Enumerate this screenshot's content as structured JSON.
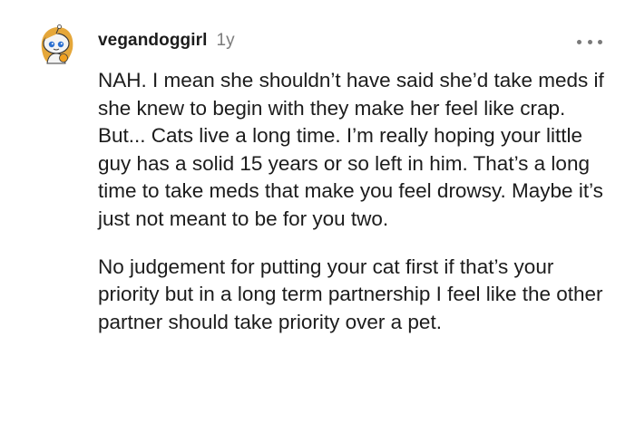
{
  "comment": {
    "username": "vegandoggirl",
    "age": "1y",
    "paragraphs": [
      "NAH. I mean she shouldn’t have said she’d take meds if she knew to begin with they make her feel like crap. But... Cats live a long time. I’m really hoping your little guy has a solid 15 years or so left in him. That’s a long time to take meds that make you feel drowsy. Maybe it’s just not meant to be for you two.",
      "No judgement for putting your cat first if that’s your priority but in a long term partnership I feel like the other partner should take priority over a pet."
    ]
  },
  "icons": {
    "avatar": "snoo-avatar-icon",
    "more": "more-options-icon"
  },
  "colors": {
    "username": "#1c1c1c",
    "age": "#7c7c7c",
    "body_text": "#1c1c1c",
    "avatar_skin": "#f2f2f2",
    "avatar_hair": "#e0a030"
  }
}
